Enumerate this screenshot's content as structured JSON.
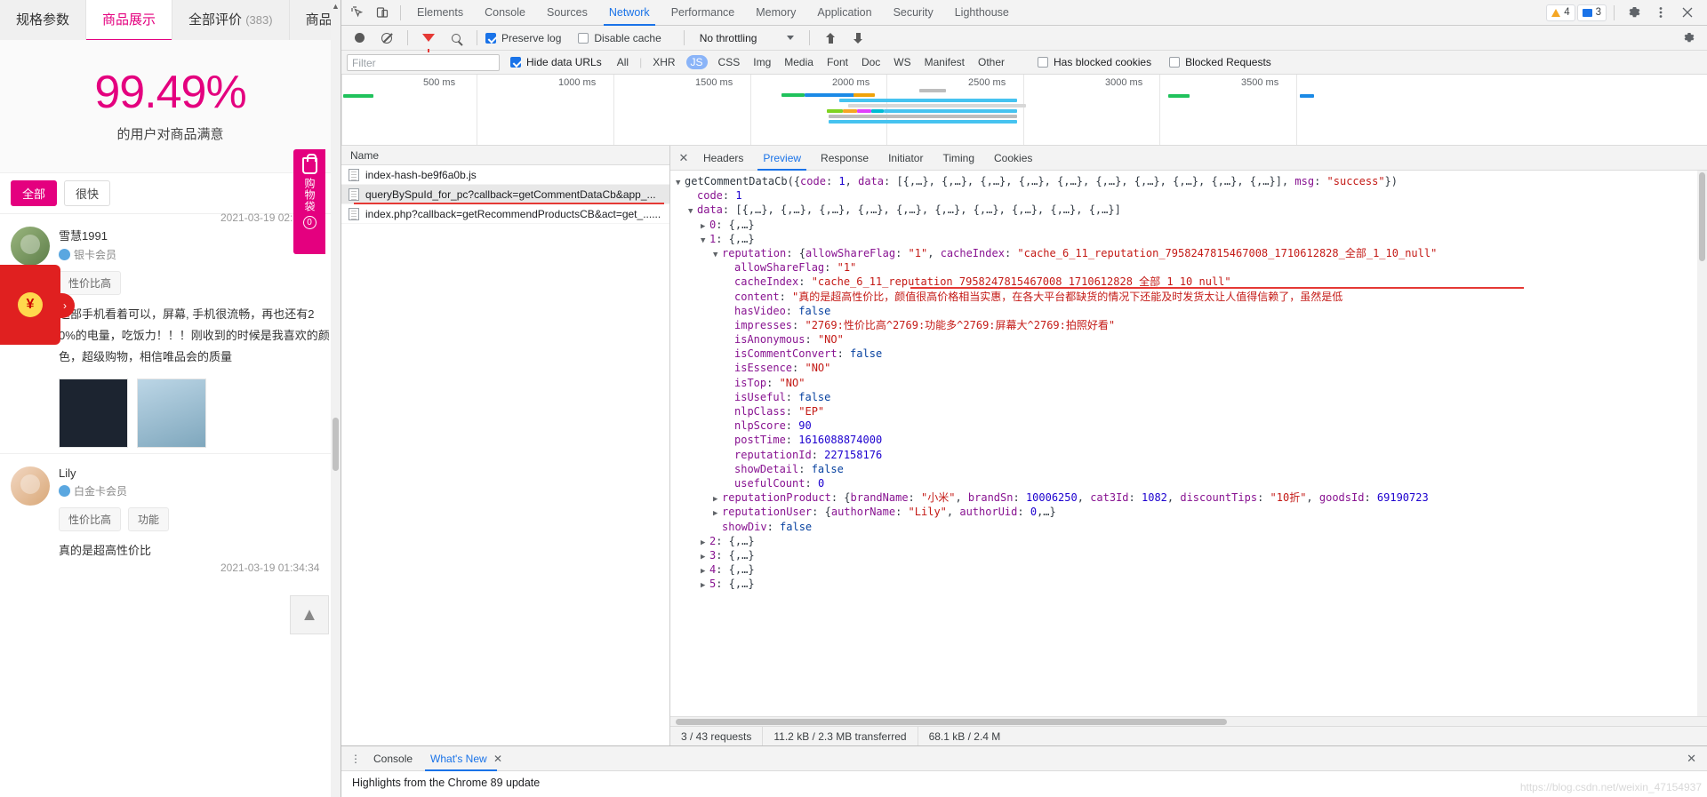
{
  "site": {
    "tabs": [
      {
        "label": "规格参数",
        "count": "",
        "active": false
      },
      {
        "label": "商品展示",
        "count": "",
        "active": true
      },
      {
        "label": "全部评价",
        "count": "(383)",
        "active": false
      },
      {
        "label": "商品咨询",
        "count": "",
        "active": false
      }
    ],
    "satisfaction": {
      "percent": "99.49%",
      "caption": "的用户对商品满意"
    },
    "chips": [
      {
        "label": "全部",
        "accent": true
      },
      {
        "label": "很快"
      }
    ],
    "reviews": [
      {
        "author": "雪慧1991",
        "level": "银卡会员",
        "date": "2021-03-19 02:",
        "tags": [
          "性价比高"
        ],
        "text": "这部手机看着可以，屏幕, 手机很流畅，再也还有20%的电量，吃饭力！！！刚收到的时候是我喜欢的颜色，超级购物，相信唯品会的质量",
        "images": [
          "dark-photo",
          "blue-photo"
        ]
      },
      {
        "author": "Lily",
        "level": "白金卡会员",
        "date": "2021-03-19 01:34:34",
        "tags": [
          "性价比高",
          "功能"
        ],
        "text": "真的是超高性价比"
      }
    ],
    "bag": {
      "icon": "shopping-bag-icon",
      "label": "购物袋",
      "count": "0"
    },
    "envelope": {
      "symbol": "¥",
      "arrow": "›"
    },
    "back_to_top": "▲"
  },
  "devtools": {
    "inspect_icons": [
      "inspect-element-icon",
      "device-toolbar-icon"
    ],
    "panels": [
      "Elements",
      "Console",
      "Sources",
      "Network",
      "Performance",
      "Memory",
      "Application",
      "Security",
      "Lighthouse"
    ],
    "active_panel": "Network",
    "badges": {
      "warnings": "4",
      "messages": "3"
    },
    "right_icons": [
      "settings-gear-icon",
      "more-options-icon",
      "close-devtools-icon"
    ],
    "controls": {
      "record_title": "record-button",
      "clear_title": "clear-button",
      "filter_title": "filter-button",
      "search_title": "search-button",
      "preserve_log": {
        "label": "Preserve log",
        "checked": true
      },
      "disable_cache": {
        "label": "Disable cache",
        "checked": false
      },
      "throttling": "No throttling",
      "import_title": "import-har-icon",
      "export_title": "export-har-icon",
      "settings_title": "network-settings-icon"
    },
    "filters": {
      "placeholder": "Filter",
      "hide_data_urls": {
        "label": "Hide data URLs",
        "checked": true
      },
      "types": [
        "All",
        "XHR",
        "JS",
        "CSS",
        "Img",
        "Media",
        "Font",
        "Doc",
        "WS",
        "Manifest",
        "Other"
      ],
      "selected_type": "JS",
      "has_blocked_cookies": {
        "label": "Has blocked cookies",
        "checked": false
      },
      "blocked_requests": {
        "label": "Blocked Requests",
        "checked": false
      }
    },
    "overview": {
      "ticks": [
        "500 ms",
        "1000 ms",
        "1500 ms",
        "2000 ms",
        "2500 ms",
        "3000 ms",
        "3500 ms"
      ]
    },
    "requests": {
      "column_header": "Name",
      "rows": [
        {
          "name": "index-hash-be9f6a0b.js",
          "selected": false,
          "underlined": false
        },
        {
          "name": "queryBySpuId_for_pc?callback=getCommentDataCb&app_...",
          "selected": true,
          "underlined": true
        },
        {
          "name": "index.php?callback=getRecommendProductsCB&act=get_......",
          "selected": false,
          "underlined": false
        }
      ]
    },
    "detail_tabs": [
      "Headers",
      "Preview",
      "Response",
      "Initiator",
      "Timing",
      "Cookies"
    ],
    "active_detail_tab": "Preview",
    "preview_lines": [
      {
        "indent": 0,
        "tri": "down",
        "parts": [
          [
            "fn",
            "getCommentDataCb({"
          ],
          [
            "k",
            "code"
          ],
          [
            "p",
            ": "
          ],
          [
            "n",
            "1"
          ],
          [
            "p",
            ", "
          ],
          [
            "k",
            "data"
          ],
          [
            "p",
            ": [{,…}, {,…}, {,…}, {,…}, {,…}, {,…}, {,…}, {,…}, {,…}, {,…}], "
          ],
          [
            "k",
            "msg"
          ],
          [
            "p",
            ": "
          ],
          [
            "s",
            "\"success\""
          ],
          [
            "p",
            "})"
          ]
        ]
      },
      {
        "indent": 1,
        "tri": "none",
        "parts": [
          [
            "k",
            "code"
          ],
          [
            "p",
            ": "
          ],
          [
            "n",
            "1"
          ]
        ]
      },
      {
        "indent": 1,
        "tri": "down",
        "parts": [
          [
            "k",
            "data"
          ],
          [
            "p",
            ": [{,…}, {,…}, {,…}, {,…}, {,…}, {,…}, {,…}, {,…}, {,…}, {,…}]"
          ]
        ]
      },
      {
        "indent": 2,
        "tri": "right",
        "parts": [
          [
            "k",
            "0"
          ],
          [
            "p",
            ": {,…}"
          ]
        ]
      },
      {
        "indent": 2,
        "tri": "down",
        "parts": [
          [
            "k",
            "1"
          ],
          [
            "p",
            ": {,…}"
          ]
        ]
      },
      {
        "indent": 3,
        "tri": "down",
        "parts": [
          [
            "k",
            "reputation"
          ],
          [
            "p",
            ": {"
          ],
          [
            "k",
            "allowShareFlag"
          ],
          [
            "p",
            ": "
          ],
          [
            "s",
            "\"1\""
          ],
          [
            "p",
            ", "
          ],
          [
            "k",
            "cacheIndex"
          ],
          [
            "p",
            ": "
          ],
          [
            "s",
            "\"cache_6_11_reputation_7958247815467008_1710612828_全部_1_10_null\""
          ]
        ]
      },
      {
        "indent": 4,
        "tri": "none",
        "parts": [
          [
            "k",
            "allowShareFlag"
          ],
          [
            "p",
            ": "
          ],
          [
            "s",
            "\"1\""
          ]
        ]
      },
      {
        "indent": 4,
        "tri": "none",
        "parts": [
          [
            "k",
            "cacheIndex"
          ],
          [
            "p",
            ": "
          ],
          [
            "s",
            "\"cache_6_11_reputation_7958247815467008_1710612828_全部_1_10_null\""
          ]
        ]
      },
      {
        "indent": 4,
        "tri": "none",
        "parts": [
          [
            "k",
            "content"
          ],
          [
            "p",
            ": "
          ],
          [
            "s",
            "\"真的是超高性价比，颜值很高价格相当实惠，在各大平台都缺货的情况下还能及时发货太让人值得信赖了，虽然是低"
          ]
        ]
      },
      {
        "indent": 4,
        "tri": "none",
        "parts": [
          [
            "k",
            "hasVideo"
          ],
          [
            "p",
            ": "
          ],
          [
            "b",
            "false"
          ]
        ]
      },
      {
        "indent": 4,
        "tri": "none",
        "parts": [
          [
            "k",
            "impresses"
          ],
          [
            "p",
            ": "
          ],
          [
            "s",
            "\"2769:性价比高^2769:功能多^2769:屏幕大^2769:拍照好看\""
          ]
        ]
      },
      {
        "indent": 4,
        "tri": "none",
        "parts": [
          [
            "k",
            "isAnonymous"
          ],
          [
            "p",
            ": "
          ],
          [
            "s",
            "\"NO\""
          ]
        ]
      },
      {
        "indent": 4,
        "tri": "none",
        "parts": [
          [
            "k",
            "isCommentConvert"
          ],
          [
            "p",
            ": "
          ],
          [
            "b",
            "false"
          ]
        ]
      },
      {
        "indent": 4,
        "tri": "none",
        "parts": [
          [
            "k",
            "isEssence"
          ],
          [
            "p",
            ": "
          ],
          [
            "s",
            "\"NO\""
          ]
        ]
      },
      {
        "indent": 4,
        "tri": "none",
        "parts": [
          [
            "k",
            "isTop"
          ],
          [
            "p",
            ": "
          ],
          [
            "s",
            "\"NO\""
          ]
        ]
      },
      {
        "indent": 4,
        "tri": "none",
        "parts": [
          [
            "k",
            "isUseful"
          ],
          [
            "p",
            ": "
          ],
          [
            "b",
            "false"
          ]
        ]
      },
      {
        "indent": 4,
        "tri": "none",
        "parts": [
          [
            "k",
            "nlpClass"
          ],
          [
            "p",
            ": "
          ],
          [
            "s",
            "\"EP\""
          ]
        ]
      },
      {
        "indent": 4,
        "tri": "none",
        "parts": [
          [
            "k",
            "nlpScore"
          ],
          [
            "p",
            ": "
          ],
          [
            "n",
            "90"
          ]
        ]
      },
      {
        "indent": 4,
        "tri": "none",
        "parts": [
          [
            "k",
            "postTime"
          ],
          [
            "p",
            ": "
          ],
          [
            "n",
            "1616088874000"
          ]
        ]
      },
      {
        "indent": 4,
        "tri": "none",
        "parts": [
          [
            "k",
            "reputationId"
          ],
          [
            "p",
            ": "
          ],
          [
            "n",
            "227158176"
          ]
        ]
      },
      {
        "indent": 4,
        "tri": "none",
        "parts": [
          [
            "k",
            "showDetail"
          ],
          [
            "p",
            ": "
          ],
          [
            "b",
            "false"
          ]
        ]
      },
      {
        "indent": 4,
        "tri": "none",
        "parts": [
          [
            "k",
            "usefulCount"
          ],
          [
            "p",
            ": "
          ],
          [
            "n",
            "0"
          ]
        ]
      },
      {
        "indent": 3,
        "tri": "right",
        "parts": [
          [
            "k",
            "reputationProduct"
          ],
          [
            "p",
            ": {"
          ],
          [
            "k",
            "brandName"
          ],
          [
            "p",
            ": "
          ],
          [
            "s",
            "\"小米\""
          ],
          [
            "p",
            ", "
          ],
          [
            "k",
            "brandSn"
          ],
          [
            "p",
            ": "
          ],
          [
            "n",
            "10006250"
          ],
          [
            "p",
            ", "
          ],
          [
            "k",
            "cat3Id"
          ],
          [
            "p",
            ": "
          ],
          [
            "n",
            "1082"
          ],
          [
            "p",
            ", "
          ],
          [
            "k",
            "discountTips"
          ],
          [
            "p",
            ": "
          ],
          [
            "s",
            "\"10折\""
          ],
          [
            "p",
            ", "
          ],
          [
            "k",
            "goodsId"
          ],
          [
            "p",
            ": "
          ],
          [
            "n",
            "69190723"
          ]
        ]
      },
      {
        "indent": 3,
        "tri": "right",
        "parts": [
          [
            "k",
            "reputationUser"
          ],
          [
            "p",
            ": {"
          ],
          [
            "k",
            "authorName"
          ],
          [
            "p",
            ": "
          ],
          [
            "s",
            "\"Lily\""
          ],
          [
            "p",
            ", "
          ],
          [
            "k",
            "authorUid"
          ],
          [
            "p",
            ": "
          ],
          [
            "n",
            "0"
          ],
          [
            "p",
            ",…}"
          ]
        ]
      },
      {
        "indent": 3,
        "tri": "none",
        "parts": [
          [
            "k",
            "showDiv"
          ],
          [
            "p",
            ": "
          ],
          [
            "b",
            "false"
          ]
        ]
      },
      {
        "indent": 2,
        "tri": "right",
        "parts": [
          [
            "k",
            "2"
          ],
          [
            "p",
            ": {,…}"
          ]
        ]
      },
      {
        "indent": 2,
        "tri": "right",
        "parts": [
          [
            "k",
            "3"
          ],
          [
            "p",
            ": {,…}"
          ]
        ]
      },
      {
        "indent": 2,
        "tri": "right",
        "parts": [
          [
            "k",
            "4"
          ],
          [
            "p",
            ": {,…}"
          ]
        ]
      },
      {
        "indent": 2,
        "tri": "right",
        "parts": [
          [
            "k",
            "5"
          ],
          [
            "p",
            ": {,…}"
          ]
        ]
      }
    ],
    "status_bar": [
      "3 / 43 requests",
      "11.2 kB / 2.3 MB transferred",
      "68.1 kB / 2.4 M"
    ],
    "drawer": {
      "tabs": [
        "Console",
        "What's New"
      ],
      "active_tab": "What's New",
      "body": "Highlights from the Chrome 89 update",
      "close_label": "✕"
    }
  },
  "watermark": "https://blog.csdn.net/weixin_47154937",
  "colors": {
    "accent_pink": "#e4007f",
    "devtools_blue": "#1a73e8",
    "red_annotation": "#e53935"
  }
}
